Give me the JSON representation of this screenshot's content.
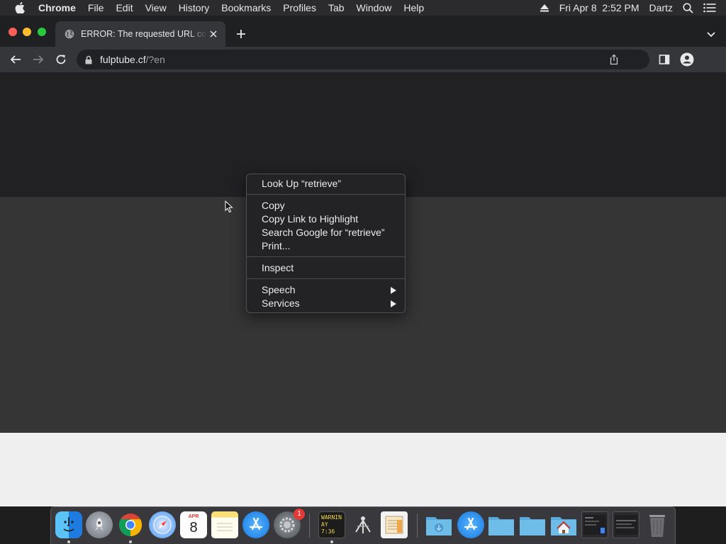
{
  "menubar": {
    "app_name": "Chrome",
    "menus": [
      "File",
      "Edit",
      "View",
      "History",
      "Bookmarks",
      "Profiles",
      "Tab",
      "Window",
      "Help"
    ],
    "date_time": "Fri Apr 8  2:52 PM",
    "user_name": "Dartz"
  },
  "browser": {
    "tab_title": "ERROR: The requested URL could not be retrieved",
    "url_host": "fulptube.cf",
    "url_path": "/?en"
  },
  "context_menu": {
    "look_up": "Look Up “retrieve”",
    "copy": "Copy",
    "copy_link": "Copy Link to Highlight",
    "search_google": "Search Google for “retrieve”",
    "print": "Print...",
    "inspect": "Inspect",
    "speech": "Speech",
    "services": "Services"
  },
  "dock": {
    "calendar_month": "APR",
    "calendar_day": "8",
    "system_prefs_badge": "1",
    "console_text_line1": "WARNIN",
    "console_text_line2": "AY 7:36"
  },
  "colors": {
    "page_background": "#353535",
    "page_top_band": "#212124",
    "menu_background": "#232325"
  }
}
